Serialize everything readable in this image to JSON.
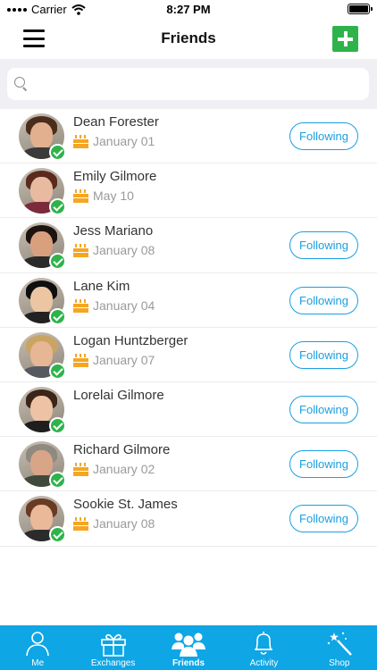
{
  "status": {
    "carrier": "Carrier",
    "time": "8:27 PM"
  },
  "nav": {
    "title": "Friends"
  },
  "search": {
    "placeholder": "",
    "value": ""
  },
  "friends": [
    {
      "name": "Dean Forester",
      "birthday": "January 01",
      "following_label": "Following",
      "skin": "#e2b08f",
      "hair": "#4a2e1b",
      "shirt": "#3a3a3a"
    },
    {
      "name": "Emily Gilmore",
      "birthday": "May 10",
      "following_label": "",
      "skin": "#e8bba0",
      "hair": "#5a2a1e",
      "shirt": "#7b2b3a"
    },
    {
      "name": "Jess Mariano",
      "birthday": "January 08",
      "following_label": "Following",
      "skin": "#d9a07e",
      "hair": "#1e140f",
      "shirt": "#2a2a2a"
    },
    {
      "name": "Lane Kim",
      "birthday": "January 04",
      "following_label": "Following",
      "skin": "#ecc6a3",
      "hair": "#0f0f10",
      "shirt": "#222222"
    },
    {
      "name": "Logan Huntzberger",
      "birthday": "January 07",
      "following_label": "Following",
      "skin": "#e6b695",
      "hair": "#c9a463",
      "shirt": "#555a60"
    },
    {
      "name": "Lorelai Gilmore",
      "birthday": "",
      "following_label": "Following",
      "skin": "#edc2a5",
      "hair": "#3b2418",
      "shirt": "#1e1e1e"
    },
    {
      "name": "Richard Gilmore",
      "birthday": "January 02",
      "following_label": "Following",
      "skin": "#d9a588",
      "hair": "#8f8a80",
      "shirt": "#3f4a3b"
    },
    {
      "name": "Sookie St. James",
      "birthday": "January 08",
      "following_label": "Following",
      "skin": "#e9b99a",
      "hair": "#6a3b24",
      "shirt": "#2b2b2b"
    }
  ],
  "tabs": [
    {
      "label": "Me",
      "icon": "person-icon"
    },
    {
      "label": "Exchanges",
      "icon": "gift-icon"
    },
    {
      "label": "Friends",
      "icon": "friends-icon",
      "active": true
    },
    {
      "label": "Activity",
      "icon": "bell-icon"
    },
    {
      "label": "Shop",
      "icon": "magic-wand-icon"
    }
  ],
  "colors": {
    "accent": "#0ea6e5",
    "add": "#2eb34b",
    "follow": "#1a9fe0",
    "cake": "#f5a623"
  }
}
